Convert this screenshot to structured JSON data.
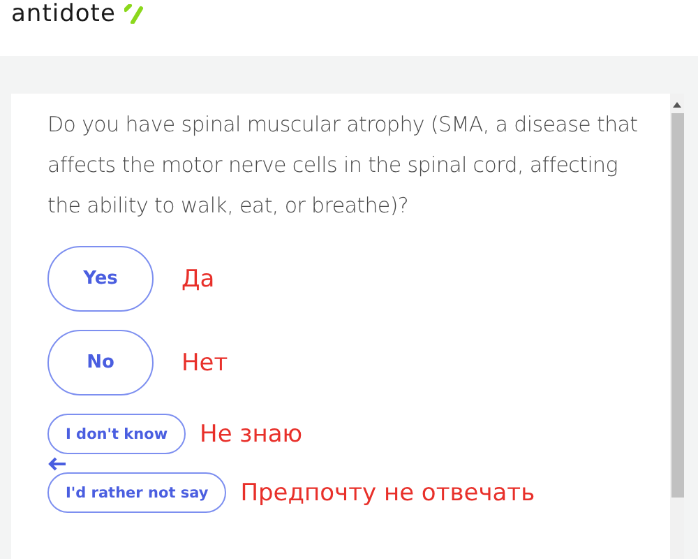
{
  "logo": {
    "text": "antidote"
  },
  "question": "Do you have spinal muscular atrophy (SMA, a disease that affects the motor nerve cells in the spinal cord, affecting the ability to walk, eat, or breathe)?",
  "options": [
    {
      "label": "Yes",
      "kind": "large",
      "note": "Да"
    },
    {
      "label": "No",
      "kind": "large",
      "note": "Нет"
    },
    {
      "label": "I don't know",
      "kind": "small",
      "note": "Не знаю"
    },
    {
      "label": "I'd rather not say",
      "kind": "small",
      "note": "Предпочту не отвечать",
      "arrow": true
    }
  ]
}
